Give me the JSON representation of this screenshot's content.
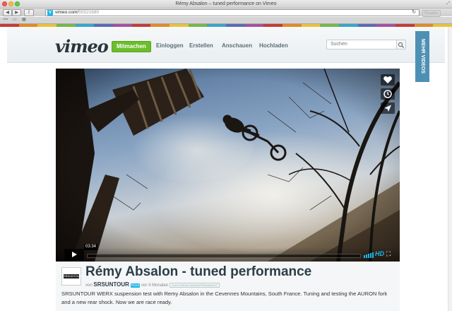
{
  "window": {
    "title": "Rémy Absalon – tuned performance on Vimeo"
  },
  "browser": {
    "url_domain": "vimeo.com/",
    "url_path": "55521680",
    "reader_label": "Reader",
    "back_icon": "back-arrow-icon",
    "forward_icon": "forward-arrow-icon"
  },
  "stripe_colors": [
    "#c33b3b",
    "#e08a2a",
    "#e9c23b",
    "#77b64a",
    "#3aa4c8",
    "#5b6bb5",
    "#a2529e",
    "#c33b3b",
    "#e08a2a",
    "#e9c23b",
    "#77b64a",
    "#3aa4c8",
    "#5b6bb5",
    "#a2529e",
    "#c33b3b",
    "#e08a2a",
    "#e9c23b",
    "#77b64a",
    "#3aa4c8",
    "#5b6bb5",
    "#a2529e",
    "#c33b3b",
    "#e08a2a",
    "#e9c23b"
  ],
  "header": {
    "logo": "vimeo",
    "nav": {
      "join": "Mitmachen",
      "login": "Einloggen",
      "create": "Erstellen",
      "watch": "Anschauen",
      "upload": "Hochladen"
    },
    "search_placeholder": "Suchen",
    "more_videos": "MEHR VIDEOS"
  },
  "player": {
    "timecode": "03:34",
    "loaded_fraction": 0.0,
    "hd_label": "HD",
    "side_buttons": [
      "heart-icon",
      "clock-icon",
      "send-icon"
    ]
  },
  "video": {
    "title": "Rémy Absalon - tuned performance",
    "by_prefix": "von",
    "author": "SRSUNTOUR",
    "author_badge": "PLUS",
    "time_ago": "vor 4 Monaten",
    "extra_badge": "ZUM DOWNLOADEN/PERMANENT",
    "avatar_text": "SRSUNTOUR",
    "description": "SRSUNTOUR WERX suspension test with Remy Absalon in the Cevennes Mountains, South France. Tuning and testing the AURON fork and a new rear shock. Now we are race ready."
  },
  "colors": {
    "vimeo_blue": "#1ab7ea",
    "join_green": "#6cbd2c",
    "more_videos_blue": "#4e90b4"
  }
}
